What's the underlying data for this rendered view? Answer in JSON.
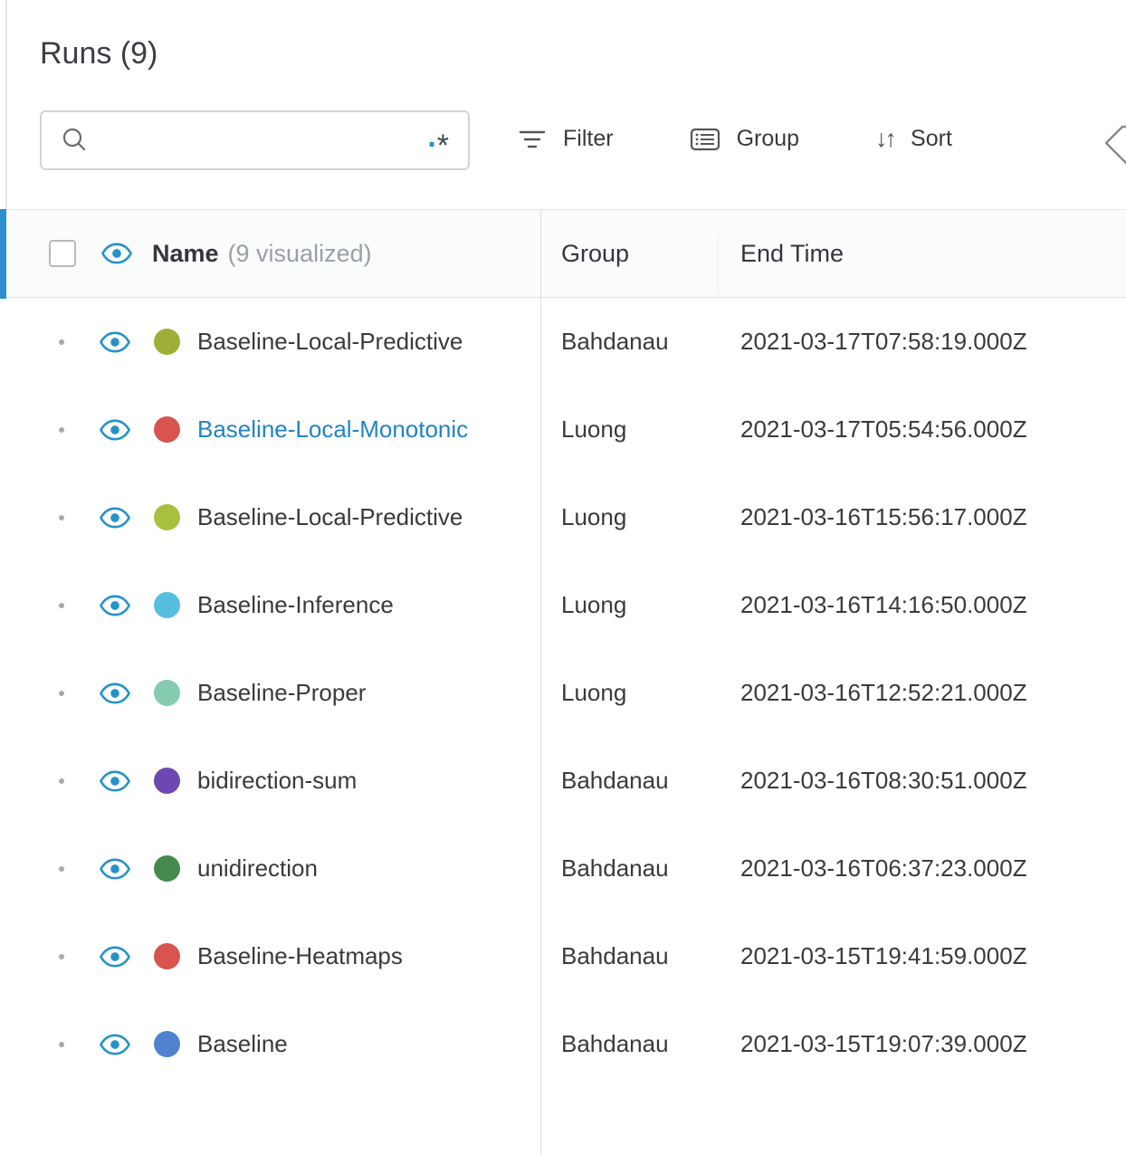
{
  "header": {
    "title": "Runs (9)",
    "search": {
      "value": "",
      "placeholder": ""
    },
    "toolbar": {
      "filter_label": "Filter",
      "group_label": "Group",
      "sort_label": "Sort",
      "sort_glyphs": "↓↑"
    },
    "regex_dot": ".",
    "regex_star": "*"
  },
  "table": {
    "columns": {
      "name": "Name",
      "name_suffix": "(9 visualized)",
      "group": "Group",
      "end_time": "End Time"
    },
    "rows": [
      {
        "name": "Baseline-Local-Predictive",
        "group": "Bahdanau",
        "end_time": "2021-03-17T07:58:19.000Z",
        "color": "#9fae37",
        "highlighted": false
      },
      {
        "name": "Baseline-Local-Monotonic",
        "group": "Luong",
        "end_time": "2021-03-17T05:54:56.000Z",
        "color": "#d9534f",
        "highlighted": true
      },
      {
        "name": "Baseline-Local-Predictive",
        "group": "Luong",
        "end_time": "2021-03-16T15:56:17.000Z",
        "color": "#a5c13f",
        "highlighted": false
      },
      {
        "name": "Baseline-Inference",
        "group": "Luong",
        "end_time": "2021-03-16T14:16:50.000Z",
        "color": "#56bfdf",
        "highlighted": false
      },
      {
        "name": "Baseline-Proper",
        "group": "Luong",
        "end_time": "2021-03-16T12:52:21.000Z",
        "color": "#85ccb1",
        "highlighted": false
      },
      {
        "name": "bidirection-sum",
        "group": "Bahdanau",
        "end_time": "2021-03-16T08:30:51.000Z",
        "color": "#6f47b0",
        "highlighted": false
      },
      {
        "name": "unidirection",
        "group": "Bahdanau",
        "end_time": "2021-03-16T06:37:23.000Z",
        "color": "#44894e",
        "highlighted": false
      },
      {
        "name": "Baseline-Heatmaps",
        "group": "Bahdanau",
        "end_time": "2021-03-15T19:41:59.000Z",
        "color": "#d9534f",
        "highlighted": false
      },
      {
        "name": "Baseline",
        "group": "Bahdanau",
        "end_time": "2021-03-15T19:07:39.000Z",
        "color": "#4f83d1",
        "highlighted": false
      }
    ]
  },
  "colors": {
    "accent_blue": "#2d8ecf",
    "eye_blue": "#2592c9",
    "link_blue": "#2383c4"
  },
  "icons": {
    "search": "search-icon",
    "regex": "regex-toggle-icon",
    "filter": "filter-icon",
    "group": "group-icon",
    "sort": "sort-icon",
    "tag": "tag-icon",
    "eye": "visibility-eye-icon"
  }
}
